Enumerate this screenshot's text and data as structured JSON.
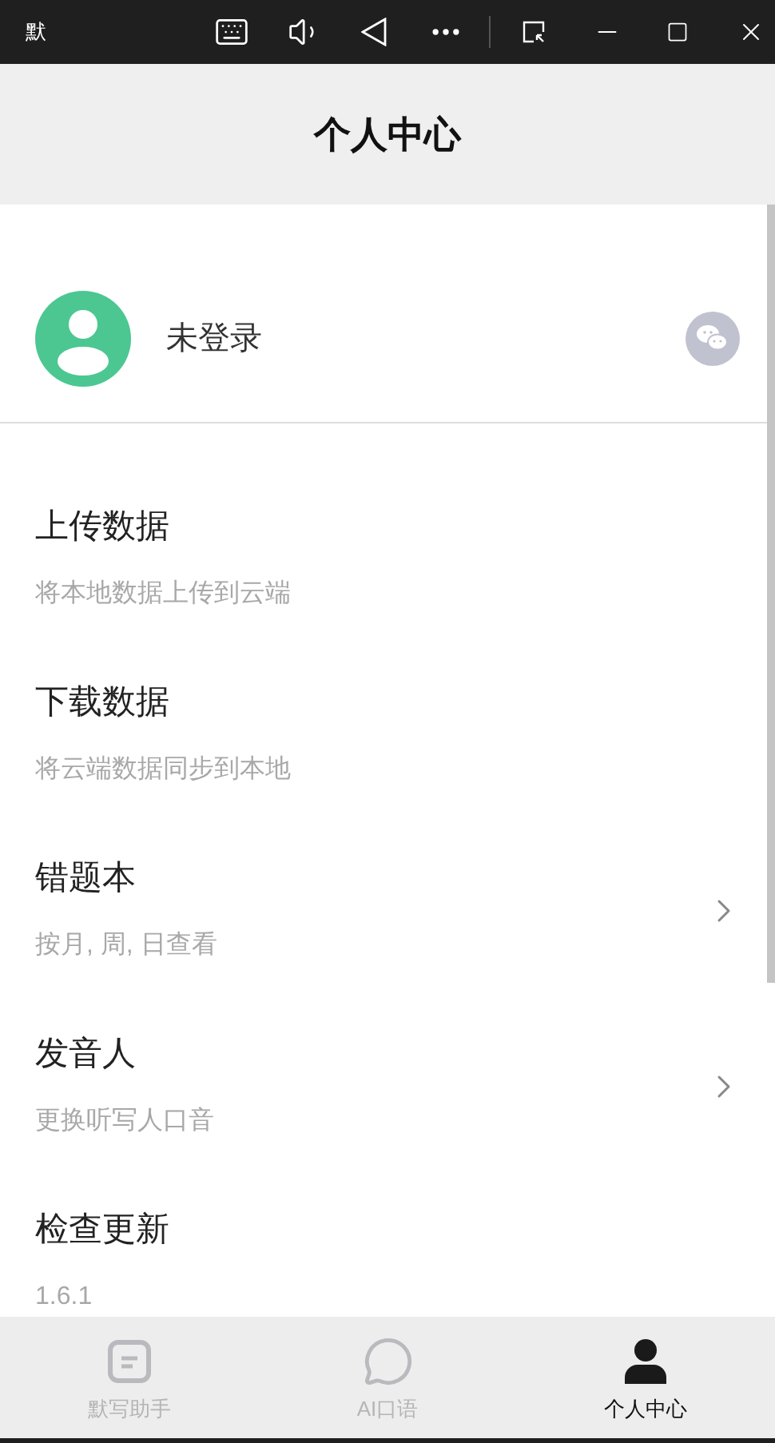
{
  "window": {
    "title": "默"
  },
  "header": {
    "title": "个人中心"
  },
  "profile": {
    "name": "未登录"
  },
  "menu": [
    {
      "title": "上传数据",
      "subtitle": "将本地数据上传到云端",
      "chevron": false
    },
    {
      "title": "下载数据",
      "subtitle": "将云端数据同步到本地",
      "chevron": false
    },
    {
      "title": "错题本",
      "subtitle": "按月, 周, 日查看",
      "chevron": true
    },
    {
      "title": "发音人",
      "subtitle": "更换听写人口音",
      "chevron": true
    },
    {
      "title": "检查更新",
      "subtitle": "1.6.1",
      "chevron": false
    }
  ],
  "tabs": [
    {
      "kind": "notes",
      "label": "默写助手",
      "selected": false
    },
    {
      "kind": "chat",
      "label": "AI口语",
      "selected": false
    },
    {
      "kind": "person",
      "label": "个人中心",
      "selected": true
    }
  ]
}
